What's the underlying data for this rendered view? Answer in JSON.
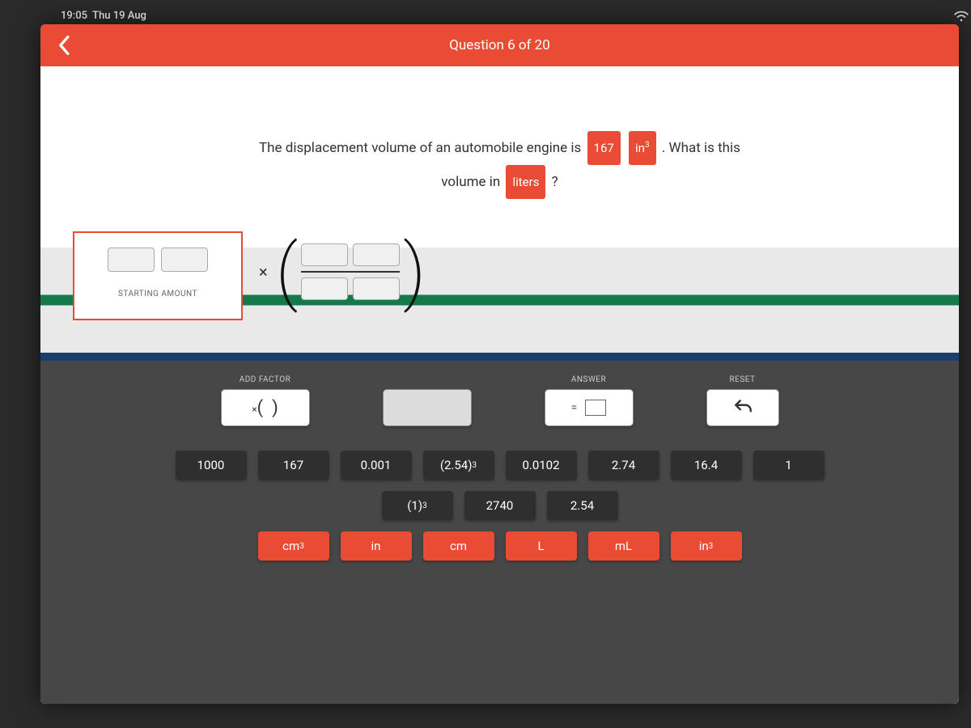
{
  "status": {
    "time": "19:05",
    "date": "Thu 19 Aug"
  },
  "header": {
    "title": "Question 6 of 20"
  },
  "question": {
    "part1": "The displacement volume of an automobile engine is",
    "chip_value": "167",
    "chip_unit_html": "in³",
    "part2": ". What is this",
    "line2_a": "volume in",
    "chip_target": "liters",
    "line2_b": "?"
  },
  "starting": {
    "label": "STARTING AMOUNT"
  },
  "tools": {
    "add_factor_label": "ADD FACTOR",
    "add_factor_text": "×( )",
    "answer_label": "ANSWER",
    "reset_label": "RESET"
  },
  "tiles": {
    "row1": [
      "1000",
      "167",
      "0.001",
      "(2.54)³",
      "0.0102",
      "2.74",
      "16.4",
      "1"
    ],
    "row2": [
      "(1)³",
      "2740",
      "2.54"
    ],
    "row3": [
      "cm³",
      "in",
      "cm",
      "L",
      "mL",
      "in³"
    ]
  }
}
